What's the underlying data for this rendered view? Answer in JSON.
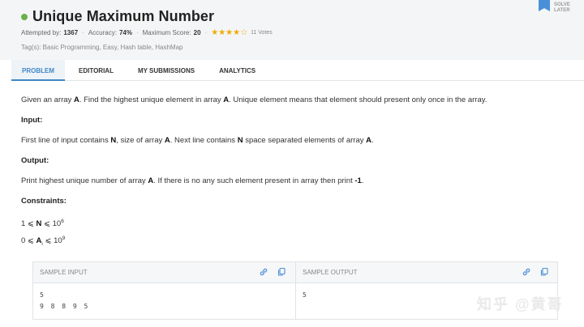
{
  "problem": {
    "title": "Unique Maximum Number",
    "attempted_label": "Attempted by:",
    "attempted_value": "1367",
    "accuracy_label": "Accuracy:",
    "accuracy_value": "74%",
    "max_score_label": "Maximum Score:",
    "max_score_value": "20",
    "stars_text": "★★★★☆",
    "rating": 3.5,
    "votes": "11 Votes",
    "tags": "Tag(s): Basic Programming, Easy, Hash table, HashMap",
    "solve_later": "SOLVE LATER"
  },
  "tabs": [
    "PROBLEM",
    "EDITORIAL",
    "MY SUBMISSIONS",
    "ANALYTICS"
  ],
  "body": {
    "desc_1": "Given an array ",
    "desc_A1": "A",
    "desc_2": ". Find the highest unique element in array ",
    "desc_A2": "A",
    "desc_3": ". Unique element means that element should present only once in the array.",
    "input_heading": "Input:",
    "input_1": "First line of input contains ",
    "input_N1": "N",
    "input_2": ", size of array ",
    "input_A1": "A",
    "input_3": ". Next line contains ",
    "input_N2": "N",
    "input_4": " space separated elements of array ",
    "input_A2": "A",
    "input_5": ".",
    "output_heading": "Output:",
    "output_1": "Print highest unique number of array ",
    "output_A": "A",
    "output_2": ". If there is no any such element present in array then print ",
    "output_val": "-1",
    "output_3": ".",
    "constraints_heading": "Constraints:",
    "c1_left": "1 ⩽ ",
    "c1_var": "N",
    "c1_right": " ⩽ 10",
    "c1_exp": "6",
    "c2_left": "0 ⩽ ",
    "c2_var": "A",
    "c2_sub": "i",
    "c2_right": " ⩽ 10",
    "c2_exp": "9"
  },
  "samples": {
    "input_label": "SAMPLE INPUT",
    "input_line1": "5",
    "input_line2": "9 8 8 9 5",
    "output_label": "SAMPLE OUTPUT",
    "output_line1": "5"
  },
  "watermark": "知乎 @黄哥",
  "colors": {
    "accent": "#3f87c5",
    "star": "#f2a900",
    "solved": "#6ab04c"
  }
}
